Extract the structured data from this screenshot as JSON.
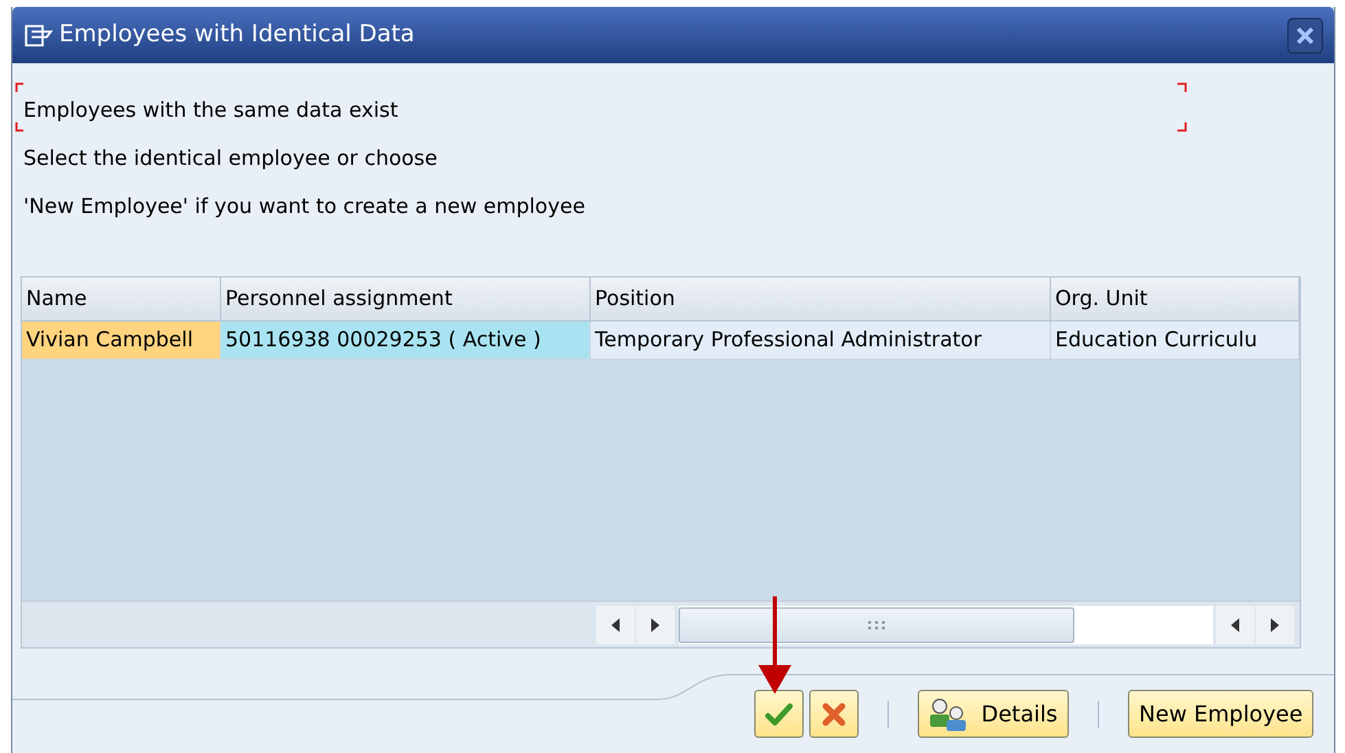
{
  "window": {
    "title": "Employees with Identical Data"
  },
  "message": [
    "Employees with the same data exist",
    "Select the identical employee or choose",
    "'New Employee' if you want to create a new employee"
  ],
  "table": {
    "columns": [
      "Name",
      "Personnel assignment",
      "Position",
      "Org. Unit"
    ],
    "rows": [
      {
        "cells": [
          {
            "text": "Vivian Campbell",
            "color": "#ffd47f"
          },
          {
            "text": "50116938 00029253 ( Active )",
            "color": "#a9e3f1"
          },
          {
            "text": "Temporary Professional Administrator",
            "color": "#e3edf7"
          },
          {
            "text": "Education Curriculu",
            "color": "#e3edf7"
          }
        ]
      }
    ]
  },
  "buttons": [
    {
      "kind": "confirm"
    },
    {
      "kind": "cancel"
    },
    {
      "kind": "details",
      "label": "Details"
    },
    {
      "kind": "text",
      "label": "New Employee"
    }
  ]
}
